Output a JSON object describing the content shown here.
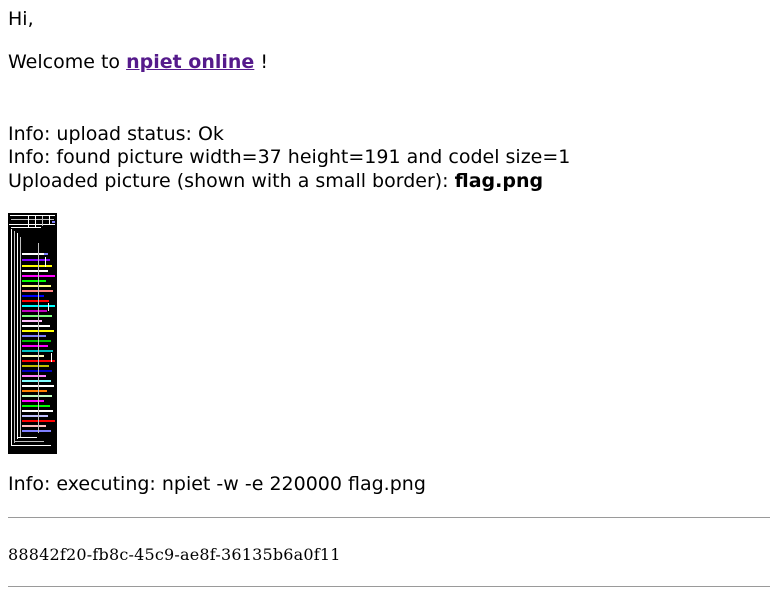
{
  "greeting": "Hi,",
  "welcome": {
    "prefix": "Welcome to ",
    "link_text": "npiet online",
    "suffix": " !"
  },
  "info": {
    "upload_status": "Info: upload status: Ok",
    "dimensions": "Info: found picture width=37 height=191 and codel size=1",
    "uploaded_prefix": "Uploaded picture (shown with a small border): ",
    "filename": "flag.png"
  },
  "executing": "Info: executing: npiet -w -e 220000 flag.png",
  "output": "88842f20-fb8c-45c9-ae8f-36135b6a0f11",
  "colors": {
    "link": "#551a8b",
    "rule": "#9a9a9a",
    "piet_background": "#000000"
  }
}
